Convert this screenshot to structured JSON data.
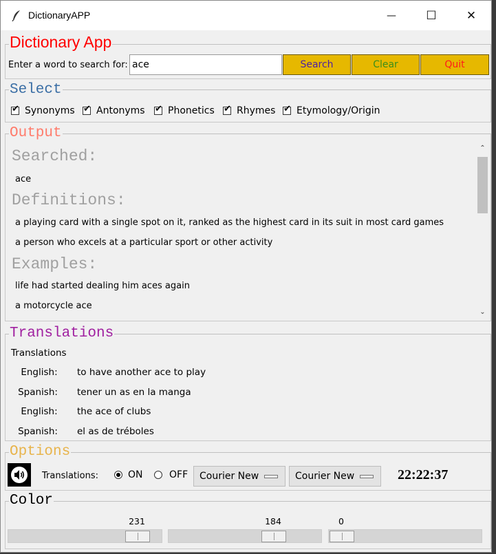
{
  "window": {
    "title": "DictionaryAPP",
    "minimize_glyph": "—",
    "maximize_glyph": "☐",
    "close_glyph": "✕"
  },
  "app": {
    "title": "Dictionary App",
    "search_prompt": "Enter a word to search for:",
    "search_value": "ace",
    "buttons": {
      "search": "Search",
      "clear": "Clear",
      "quit": "Quit"
    },
    "button_colors": {
      "search": "#4b1fa6",
      "clear": "#3b8f1a",
      "quit": "#ff1a1a",
      "background": "#e6b800"
    }
  },
  "select": {
    "legend": "Select",
    "options": [
      {
        "label": "Synonyms",
        "checked": true
      },
      {
        "label": "Antonyms",
        "checked": true
      },
      {
        "label": "Phonetics",
        "checked": true
      },
      {
        "label": "Rhymes",
        "checked": true
      },
      {
        "label": "Etymology/Origin",
        "checked": true
      }
    ]
  },
  "output": {
    "legend": "Output",
    "searched_heading": "Searched:",
    "searched_value": "ace",
    "definitions_heading": "Definitions:",
    "definitions": [
      "a playing card with a single spot on it, ranked as the highest card in its suit in most card games",
      "a person who excels at a particular sport or other activity"
    ],
    "examples_heading": "Examples:",
    "examples": [
      "life had started dealing him aces again",
      "a motorcycle ace"
    ]
  },
  "translations": {
    "legend": "Translations",
    "heading": "Translations",
    "rows": [
      {
        "language": "English:",
        "text": "to have another ace to play"
      },
      {
        "language": "Spanish:",
        "text": "tener un as en la manga"
      },
      {
        "language": "English:",
        "text": "the ace of clubs"
      },
      {
        "language": "Spanish:",
        "text": "el as de tréboles"
      }
    ]
  },
  "options": {
    "legend": "Options",
    "speaker_icon": "speaker-icon",
    "translations_label": "Translations:",
    "radio_on": "ON",
    "radio_off": "OFF",
    "selected": "ON",
    "font_dropdown_1": "Courier New",
    "font_dropdown_2": "Courier New",
    "clock": "22:22:37"
  },
  "color": {
    "legend": "Color",
    "red": 231,
    "green": 184,
    "blue": 0,
    "scale_max": 255
  },
  "accent_colors": {
    "title": "#ff0000",
    "select_legend": "#3a6ea5",
    "output_legend": "#ff7b6b",
    "translations_legend": "#a020a0",
    "options_legend": "#e8b44c",
    "color_legend": "#000000"
  }
}
